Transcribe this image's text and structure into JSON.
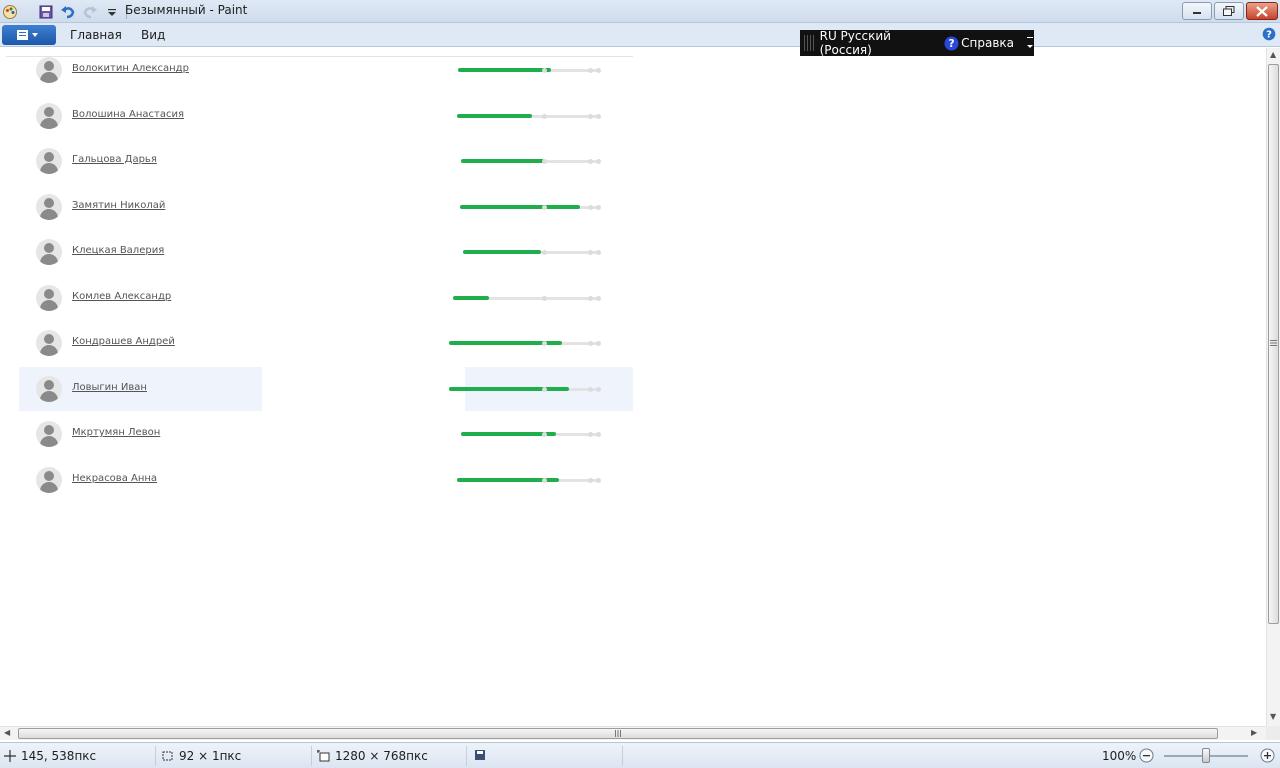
{
  "window": {
    "title": "Безымянный - Paint"
  },
  "ribbon": {
    "tabs": [
      "Главная",
      "Вид"
    ]
  },
  "langbar": {
    "language": "RU Русский (Россия)",
    "help_label": "Справка"
  },
  "users": [
    {
      "name": "Волокитин Александр",
      "progress": 0.62
    },
    {
      "name": "Волошина Анастасия",
      "progress": 0.5
    },
    {
      "name": "Гальцова Дарья",
      "progress": 0.55
    },
    {
      "name": "Замятин Николай",
      "progress": 0.8
    },
    {
      "name": "Клецкая Валерия",
      "progress": 0.52
    },
    {
      "name": "Комлев Александр",
      "progress": 0.24
    },
    {
      "name": "Кондрашев Андрей",
      "progress": 0.75
    },
    {
      "name": "Ловыгин Иван",
      "progress": 0.8
    },
    {
      "name": "Мкртумян Левон",
      "progress": 0.63
    },
    {
      "name": "Некрасова Анна",
      "progress": 0.68
    }
  ],
  "status": {
    "cursor_position": "145, 538пкс",
    "selection_size": "92 × 1пкс",
    "image_size": "1280 × 768пкс",
    "zoom": "100%"
  },
  "colors": {
    "progress": "#1fae4b",
    "highlight": "#eef3fc"
  }
}
